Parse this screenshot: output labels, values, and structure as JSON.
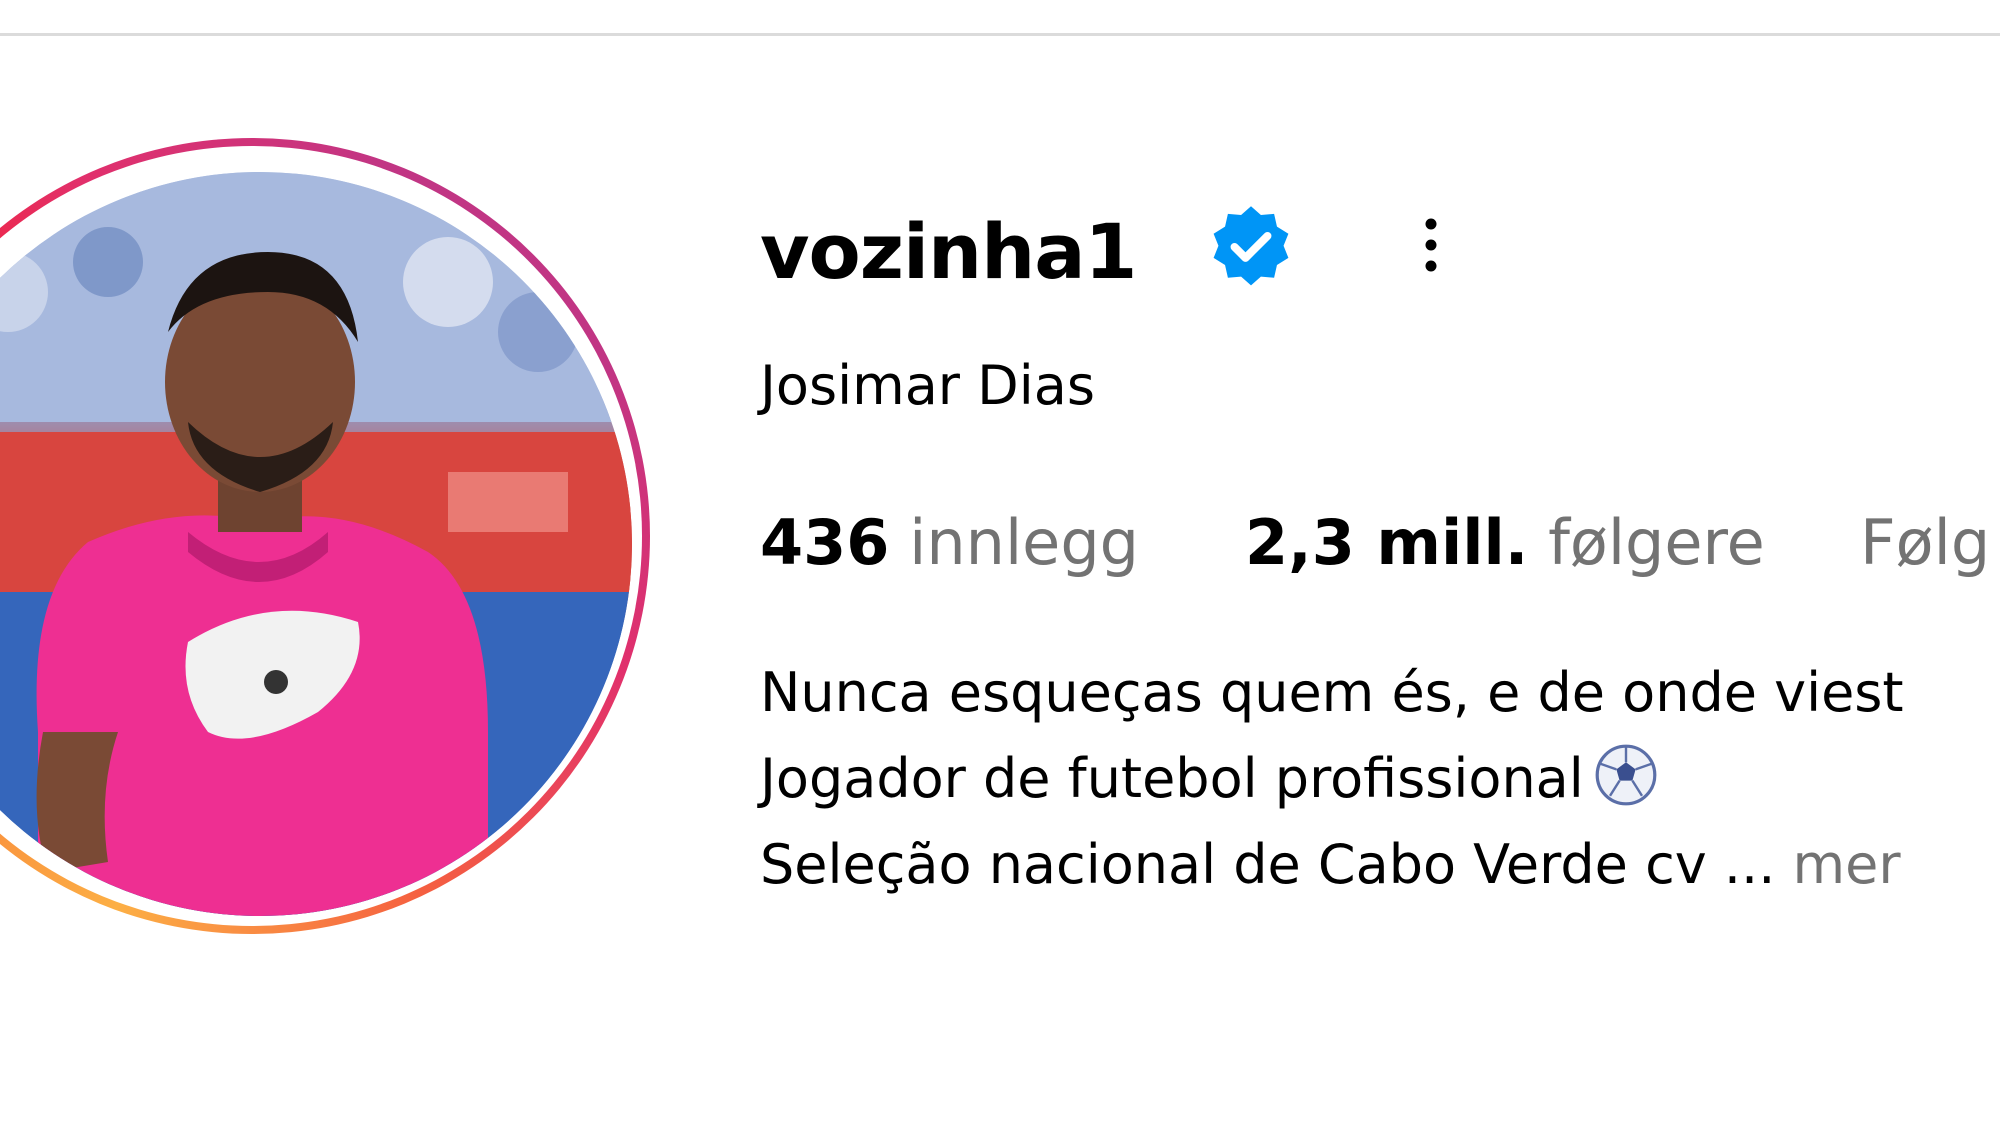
{
  "profile": {
    "username": "vozinha1",
    "full_name": "Josimar Dias",
    "verified": true
  },
  "icons": {
    "verified": "verified-badge-icon",
    "more": "more-options-icon",
    "soccer": "soccer-ball-emoji"
  },
  "stats": {
    "posts": {
      "value": "436",
      "label": "innlegg"
    },
    "followers": {
      "value": "2,3 mill.",
      "label": "følgere"
    },
    "following": {
      "label": "Følg"
    }
  },
  "bio": {
    "line1": "Nunca esqueças quem és, e de onde viest",
    "line2": "Jogador de futebol profissional",
    "line3": "Seleção nacional de Cabo Verde cv ...",
    "more_label": "mer"
  },
  "colors": {
    "verified_blue": "#0095f6",
    "secondary_text": "#737373",
    "divider": "#dbdbdb"
  }
}
